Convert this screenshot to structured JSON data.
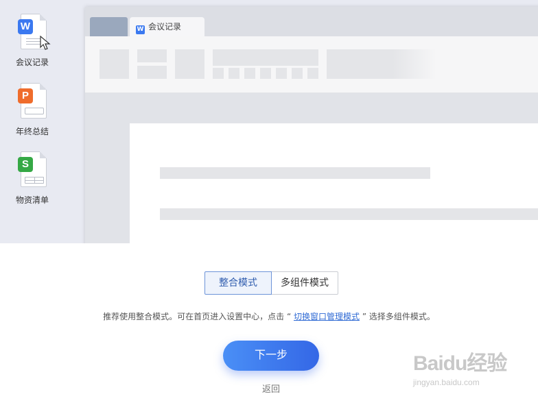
{
  "desktop": {
    "icons": [
      {
        "label": "会议记录",
        "badge": "W",
        "color": "#3b79f0"
      },
      {
        "label": "年终总结",
        "badge": "P",
        "color": "#ef6c2c"
      },
      {
        "label": "物资清单",
        "badge": "S",
        "color": "#35a845"
      }
    ]
  },
  "window": {
    "active_tab": "会议记录",
    "tab_badge": "W"
  },
  "mode": {
    "options": [
      "整合模式",
      "多组件模式"
    ],
    "selected": "整合模式"
  },
  "hint": {
    "prefix": "推荐使用整合模式。可在首页进入设置中心，点击",
    "open_quote": "“",
    "link": "切换窗口管理模式",
    "close_quote": "”",
    "suffix": "选择多组件模式。"
  },
  "actions": {
    "next": "下一步",
    "back": "返回"
  },
  "watermark": {
    "brand": "Baidu经验",
    "url": "jingyan.baidu.com"
  }
}
